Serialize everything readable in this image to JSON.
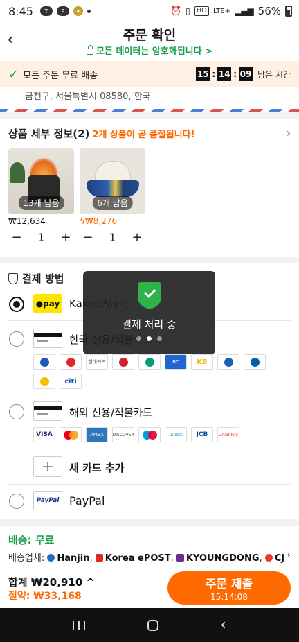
{
  "status_bar": {
    "time": "8:45",
    "battery": "56%",
    "network": "LTE+",
    "hd": "HD"
  },
  "header": {
    "title": "주문 확인",
    "secure_text": "모든 데이터는 암호화됩니다 >"
  },
  "banner": {
    "text": "모든 주문 무료 배송",
    "timer": [
      "15",
      "14",
      "09"
    ],
    "timer_label": "남은 시간"
  },
  "address": "금천구, 서울특별시 08580, 한국",
  "products": {
    "heading": "상품 세부 정보(2)",
    "warning": "2개 상품이 곧 품절됩니다!",
    "items": [
      {
        "remaining": "13개 남음",
        "price": "₩12,634",
        "qty": "1"
      },
      {
        "remaining": "6개 남음",
        "price": "₩8,276",
        "qty": "1"
      }
    ]
  },
  "payment": {
    "heading": "결제 방법",
    "kakao_logo": "●pay",
    "kakao_label": "KakaoPay",
    "kr_card_label": "한국 신용/직불카드",
    "kr_brands": [
      "신한",
      "",
      "현대카드",
      "",
      "",
      "BC",
      "KB",
      "",
      "",
      "citi"
    ],
    "intl_card_label": "해외 신용/직불카드",
    "intl_brands": [
      "VISA",
      "",
      "AMEX",
      "DISCOVER",
      "",
      "Diners",
      "JCB",
      "UnionPay"
    ],
    "add_card_label": "새 카드 추가",
    "paypal_logo": "PayPal",
    "paypal_label": "PayPal"
  },
  "shipping": {
    "heading": "배송: 무료",
    "carriers_label": "배송업체:",
    "carriers": [
      "Hanjin",
      "Korea ePOST",
      "KYOUNGDONG",
      "CJ"
    ]
  },
  "bottom": {
    "total": "합계 ₩20,910 ^",
    "saving": "절약: ₩33,168",
    "submit_label": "주문 제출",
    "submit_timer": "15:14:08"
  },
  "toast": {
    "message": "결제 처리 중"
  },
  "colors": {
    "accent": "#ff6a00",
    "secure_green": "#1a9e4b",
    "kakao_yellow": "#fee500"
  }
}
